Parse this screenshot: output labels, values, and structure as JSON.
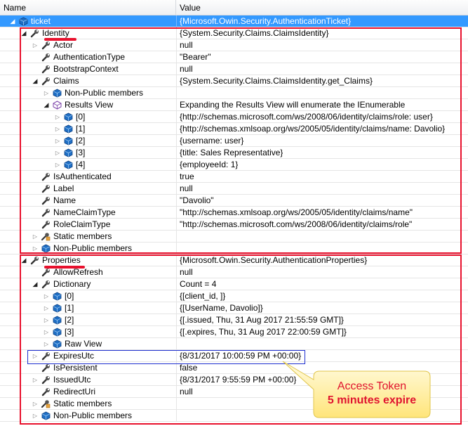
{
  "header": {
    "name": "Name",
    "value": "Value"
  },
  "rows": [
    {
      "label": "ticket",
      "value": "{Microsoft.Owin.Security.AuthenticationTicket}",
      "indent": 0,
      "tri": "exp",
      "icon": "object",
      "sel": true
    },
    {
      "label": "Identity",
      "value": "{System.Security.Claims.ClaimsIdentity}",
      "indent": 1,
      "tri": "exp",
      "icon": "property"
    },
    {
      "label": "Actor",
      "value": "null",
      "indent": 2,
      "tri": "col",
      "icon": "property"
    },
    {
      "label": "AuthenticationType",
      "value": "\"Bearer\"",
      "indent": 2,
      "tri": "",
      "icon": "property"
    },
    {
      "label": "BootstrapContext",
      "value": "null",
      "indent": 2,
      "tri": "",
      "icon": "property"
    },
    {
      "label": "Claims",
      "value": "{System.Security.Claims.ClaimsIdentity.get_Claims}",
      "indent": 2,
      "tri": "exp",
      "icon": "property"
    },
    {
      "label": "Non-Public members",
      "value": "",
      "indent": 3,
      "tri": "col",
      "icon": "object"
    },
    {
      "label": "Results View",
      "value": "Expanding the Results View will enumerate the IEnumerable",
      "indent": 3,
      "tri": "exp",
      "icon": "results"
    },
    {
      "label": "[0]",
      "value": "{http://schemas.microsoft.com/ws/2008/06/identity/claims/role: user}",
      "indent": 4,
      "tri": "col",
      "icon": "object"
    },
    {
      "label": "[1]",
      "value": "{http://schemas.xmlsoap.org/ws/2005/05/identity/claims/name: Davolio}",
      "indent": 4,
      "tri": "col",
      "icon": "object"
    },
    {
      "label": "[2]",
      "value": "{username: user}",
      "indent": 4,
      "tri": "col",
      "icon": "object"
    },
    {
      "label": "[3]",
      "value": "{title: Sales Representative}",
      "indent": 4,
      "tri": "col",
      "icon": "object"
    },
    {
      "label": "[4]",
      "value": "{employeeId: 1}",
      "indent": 4,
      "tri": "col",
      "icon": "object"
    },
    {
      "label": "IsAuthenticated",
      "value": "true",
      "indent": 2,
      "tri": "",
      "icon": "property"
    },
    {
      "label": "Label",
      "value": "null",
      "indent": 2,
      "tri": "",
      "icon": "property"
    },
    {
      "label": "Name",
      "value": "\"Davolio\"",
      "indent": 2,
      "tri": "",
      "icon": "property"
    },
    {
      "label": "NameClaimType",
      "value": "\"http://schemas.xmlsoap.org/ws/2005/05/identity/claims/name\"",
      "indent": 2,
      "tri": "",
      "icon": "property"
    },
    {
      "label": "RoleClaimType",
      "value": "\"http://schemas.microsoft.com/ws/2008/06/identity/claims/role\"",
      "indent": 2,
      "tri": "",
      "icon": "property"
    },
    {
      "label": "Static members",
      "value": "",
      "indent": 2,
      "tri": "col",
      "icon": "static"
    },
    {
      "label": "Non-Public members",
      "value": "",
      "indent": 2,
      "tri": "col",
      "icon": "object"
    },
    {
      "label": "Properties",
      "value": "{Microsoft.Owin.Security.AuthenticationProperties}",
      "indent": 1,
      "tri": "exp",
      "icon": "property"
    },
    {
      "label": "AllowRefresh",
      "value": "null",
      "indent": 2,
      "tri": "",
      "icon": "property"
    },
    {
      "label": "Dictionary",
      "value": "Count = 4",
      "indent": 2,
      "tri": "exp",
      "icon": "property"
    },
    {
      "label": "[0]",
      "value": "{[client_id, ]}",
      "indent": 3,
      "tri": "col",
      "icon": "object"
    },
    {
      "label": "[1]",
      "value": "{[UserName, Davolio]}",
      "indent": 3,
      "tri": "col",
      "icon": "object"
    },
    {
      "label": "[2]",
      "value": "{[.issued, Thu, 31 Aug 2017 21:55:59 GMT]}",
      "indent": 3,
      "tri": "col",
      "icon": "object"
    },
    {
      "label": "[3]",
      "value": "{[.expires, Thu, 31 Aug 2017 22:00:59 GMT]}",
      "indent": 3,
      "tri": "col",
      "icon": "object"
    },
    {
      "label": "Raw View",
      "value": "",
      "indent": 3,
      "tri": "col",
      "icon": "object"
    },
    {
      "label": "ExpiresUtc",
      "value": "{8/31/2017 10:00:59 PM +00:00}",
      "indent": 2,
      "tri": "col",
      "icon": "property"
    },
    {
      "label": "IsPersistent",
      "value": "false",
      "indent": 2,
      "tri": "",
      "icon": "property"
    },
    {
      "label": "IssuedUtc",
      "value": "{8/31/2017 9:55:59 PM +00:00}",
      "indent": 2,
      "tri": "col",
      "icon": "property"
    },
    {
      "label": "RedirectUri",
      "value": "null",
      "indent": 2,
      "tri": "",
      "icon": "property"
    },
    {
      "label": "Static members",
      "value": "",
      "indent": 2,
      "tri": "col",
      "icon": "static"
    },
    {
      "label": "Non-Public members",
      "value": "",
      "indent": 2,
      "tri": "col",
      "icon": "object"
    }
  ],
  "callout": {
    "line1": "Access Token",
    "line2": "5 minutes expire"
  },
  "colors": {
    "annotation_red": "#e8112d",
    "annotation_blue": "#1f2fcf",
    "selection": "#3399ff",
    "callout_fill": "#fff3a8"
  }
}
